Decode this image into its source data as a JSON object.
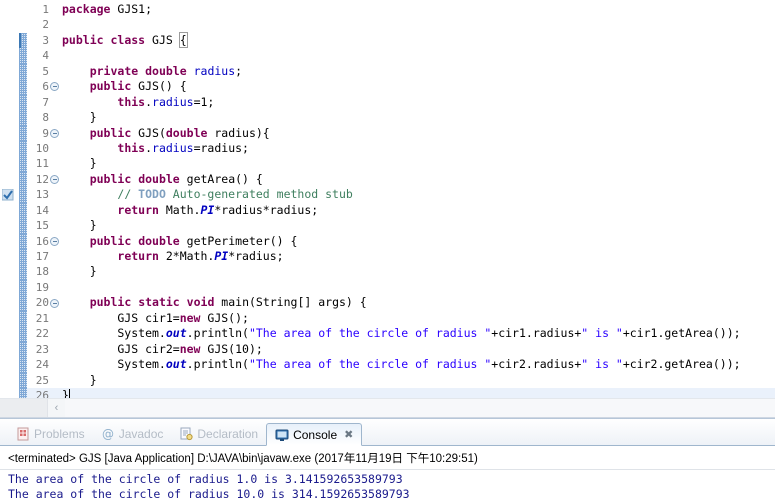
{
  "editor": {
    "caret_line": 26,
    "lines": [
      {
        "n": 1,
        "fold": false,
        "changed": false,
        "todo": false,
        "tokens": [
          [
            "kw",
            "package"
          ],
          [
            "plain",
            " GJS1;"
          ]
        ]
      },
      {
        "n": 2,
        "fold": false,
        "changed": false,
        "todo": false,
        "tokens": []
      },
      {
        "n": 3,
        "fold": false,
        "changed": true,
        "todo": false,
        "tokens": [
          [
            "kw",
            "public"
          ],
          [
            "plain",
            " "
          ],
          [
            "kw",
            "class"
          ],
          [
            "plain",
            " GJS "
          ],
          [
            "brkt",
            "{"
          ]
        ]
      },
      {
        "n": 4,
        "fold": false,
        "changed": true,
        "todo": false,
        "tokens": []
      },
      {
        "n": 5,
        "fold": false,
        "changed": true,
        "todo": false,
        "tokens": [
          [
            "plain",
            "    "
          ],
          [
            "kw",
            "private"
          ],
          [
            "plain",
            " "
          ],
          [
            "kw",
            "double"
          ],
          [
            "plain",
            " "
          ],
          [
            "fld",
            "radius"
          ],
          [
            "plain",
            ";"
          ]
        ]
      },
      {
        "n": 6,
        "fold": true,
        "changed": true,
        "todo": false,
        "tokens": [
          [
            "plain",
            "    "
          ],
          [
            "kw",
            "public"
          ],
          [
            "plain",
            " GJS() {"
          ]
        ]
      },
      {
        "n": 7,
        "fold": false,
        "changed": true,
        "todo": false,
        "tokens": [
          [
            "plain",
            "        "
          ],
          [
            "kw",
            "this"
          ],
          [
            "plain",
            "."
          ],
          [
            "fld",
            "radius"
          ],
          [
            "plain",
            "=1;"
          ]
        ]
      },
      {
        "n": 8,
        "fold": false,
        "changed": true,
        "todo": false,
        "tokens": [
          [
            "plain",
            "    }"
          ]
        ]
      },
      {
        "n": 9,
        "fold": true,
        "changed": true,
        "todo": false,
        "tokens": [
          [
            "plain",
            "    "
          ],
          [
            "kw",
            "public"
          ],
          [
            "plain",
            " GJS("
          ],
          [
            "kw",
            "double"
          ],
          [
            "plain",
            " radius){"
          ]
        ]
      },
      {
        "n": 10,
        "fold": false,
        "changed": true,
        "todo": false,
        "tokens": [
          [
            "plain",
            "        "
          ],
          [
            "kw",
            "this"
          ],
          [
            "plain",
            "."
          ],
          [
            "fld",
            "radius"
          ],
          [
            "plain",
            "=radius;"
          ]
        ]
      },
      {
        "n": 11,
        "fold": false,
        "changed": true,
        "todo": false,
        "tokens": [
          [
            "plain",
            "    }"
          ]
        ]
      },
      {
        "n": 12,
        "fold": true,
        "changed": true,
        "todo": false,
        "tokens": [
          [
            "plain",
            "    "
          ],
          [
            "kw",
            "public"
          ],
          [
            "plain",
            " "
          ],
          [
            "kw",
            "double"
          ],
          [
            "plain",
            " getArea() {"
          ]
        ]
      },
      {
        "n": 13,
        "fold": false,
        "changed": true,
        "todo": true,
        "tokens": [
          [
            "plain",
            "        "
          ],
          [
            "cmt",
            "// "
          ],
          [
            "todo",
            "TODO"
          ],
          [
            "cmt",
            " Auto-generated method stub"
          ]
        ]
      },
      {
        "n": 14,
        "fold": false,
        "changed": true,
        "todo": false,
        "tokens": [
          [
            "plain",
            "        "
          ],
          [
            "kw",
            "return"
          ],
          [
            "plain",
            " Math."
          ],
          [
            "stat",
            "PI"
          ],
          [
            "plain",
            "*radius*radius;"
          ]
        ]
      },
      {
        "n": 15,
        "fold": false,
        "changed": true,
        "todo": false,
        "tokens": [
          [
            "plain",
            "    }"
          ]
        ]
      },
      {
        "n": 16,
        "fold": true,
        "changed": true,
        "todo": false,
        "tokens": [
          [
            "plain",
            "    "
          ],
          [
            "kw",
            "public"
          ],
          [
            "plain",
            " "
          ],
          [
            "kw",
            "double"
          ],
          [
            "plain",
            " getPerimeter() {"
          ]
        ]
      },
      {
        "n": 17,
        "fold": false,
        "changed": true,
        "todo": false,
        "tokens": [
          [
            "plain",
            "        "
          ],
          [
            "kw",
            "return"
          ],
          [
            "plain",
            " 2*Math."
          ],
          [
            "stat",
            "PI"
          ],
          [
            "plain",
            "*radius;"
          ]
        ]
      },
      {
        "n": 18,
        "fold": false,
        "changed": true,
        "todo": false,
        "tokens": [
          [
            "plain",
            "    }"
          ]
        ]
      },
      {
        "n": 19,
        "fold": false,
        "changed": true,
        "todo": false,
        "tokens": []
      },
      {
        "n": 20,
        "fold": true,
        "changed": true,
        "todo": false,
        "tokens": [
          [
            "plain",
            "    "
          ],
          [
            "kw",
            "public"
          ],
          [
            "plain",
            " "
          ],
          [
            "kw",
            "static"
          ],
          [
            "plain",
            " "
          ],
          [
            "kw",
            "void"
          ],
          [
            "plain",
            " main(String[] args) {"
          ]
        ]
      },
      {
        "n": 21,
        "fold": false,
        "changed": true,
        "todo": false,
        "tokens": [
          [
            "plain",
            "        GJS cir1="
          ],
          [
            "kw",
            "new"
          ],
          [
            "plain",
            " GJS();"
          ]
        ]
      },
      {
        "n": 22,
        "fold": false,
        "changed": true,
        "todo": false,
        "tokens": [
          [
            "plain",
            "        System."
          ],
          [
            "stat",
            "out"
          ],
          [
            "plain",
            ".println("
          ],
          [
            "str",
            "\"The area of the circle of radius \""
          ],
          [
            "plain",
            "+cir1.radius+"
          ],
          [
            "str",
            "\" is \""
          ],
          [
            "plain",
            "+cir1.getArea());"
          ]
        ]
      },
      {
        "n": 23,
        "fold": false,
        "changed": true,
        "todo": false,
        "tokens": [
          [
            "plain",
            "        GJS cir2="
          ],
          [
            "kw",
            "new"
          ],
          [
            "plain",
            " GJS(10);"
          ]
        ]
      },
      {
        "n": 24,
        "fold": false,
        "changed": true,
        "todo": false,
        "tokens": [
          [
            "plain",
            "        System."
          ],
          [
            "stat",
            "out"
          ],
          [
            "plain",
            ".println("
          ],
          [
            "str",
            "\"The area of the circle of radius \""
          ],
          [
            "plain",
            "+cir2.radius+"
          ],
          [
            "str",
            "\" is \""
          ],
          [
            "plain",
            "+cir2.getArea());"
          ]
        ]
      },
      {
        "n": 25,
        "fold": false,
        "changed": true,
        "todo": false,
        "tokens": [
          [
            "plain",
            "    }"
          ]
        ]
      },
      {
        "n": 26,
        "fold": false,
        "changed": true,
        "todo": false,
        "tokens": [
          [
            "plain",
            "}"
          ]
        ]
      }
    ],
    "scrollbar": {
      "left_arrow": "‹"
    }
  },
  "bottom_panel": {
    "tabs": [
      {
        "label": "Problems",
        "icon": "problems-icon",
        "active": false,
        "closable": false
      },
      {
        "label": "Javadoc",
        "icon": "javadoc-icon",
        "active": false,
        "closable": false
      },
      {
        "label": "Declaration",
        "icon": "declaration-icon",
        "active": false,
        "closable": false
      },
      {
        "label": "Console",
        "icon": "console-icon",
        "active": true,
        "closable": true
      }
    ],
    "close_glyph": "✖",
    "console": {
      "header": "<terminated> GJS [Java Application] D:\\JAVA\\bin\\javaw.exe (2017年11月19日 下午10:29:51)",
      "output": [
        "The area of the circle of radius 1.0 is 3.141592653589793",
        "The area of the circle of radius 10.0 is 314.1592653589793"
      ]
    }
  },
  "colors": {
    "keyword": "#7f0055",
    "field": "#0000c0",
    "string": "#2a00ff",
    "comment": "#3f7f5f",
    "todo_tag": "#7f9fbf",
    "console_text": "#1a1a8c",
    "current_line": "#eaf1fb",
    "change_bar": "#7fa8d6"
  }
}
